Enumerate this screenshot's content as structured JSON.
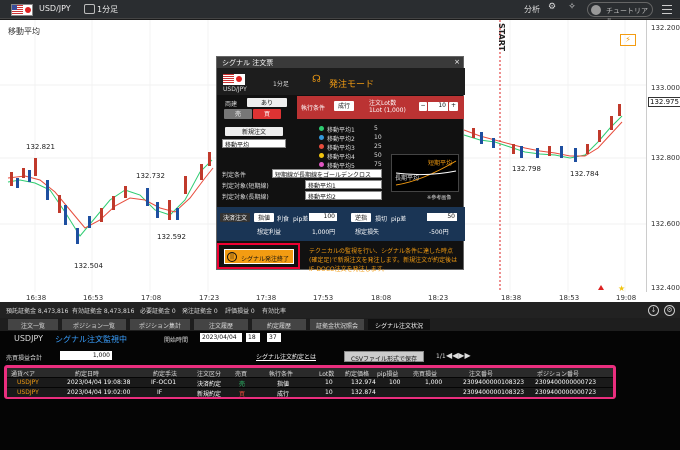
{
  "topbar": {
    "pair": "USD/JPY",
    "timeframe": "1分足",
    "analysis": "分析",
    "tutorial": "チュートリアル"
  },
  "chart": {
    "title": "移動平均",
    "start_label": "START",
    "yticks": [
      "132.200",
      "133.000",
      "132.975",
      "132.800",
      "132.600",
      "132.400"
    ],
    "xticks": [
      "16:38",
      "16:53",
      "17:08",
      "17:23",
      "17:38",
      "17:53",
      "18:08",
      "18:23",
      "18:38",
      "18:53",
      "19:08"
    ],
    "annotations": [
      "132.821",
      "132.732",
      "132.592",
      "132.504",
      "132.798",
      "132.784"
    ]
  },
  "modal": {
    "title": "シグナル 注文票",
    "pair": "USD/JPY",
    "tf": "1分足",
    "mode": "発注モード",
    "open_label": "両建",
    "open_value": "あり",
    "sell": "売",
    "buy": "買",
    "order_cond": "執行条件",
    "exec": "成行",
    "lot_label": "注文Lot数",
    "lot_sub": "1Lot (1,000)",
    "lot_value": "10",
    "new_order": "新規注文",
    "indicator": "移動平均",
    "ma": [
      {
        "n": "移動平均1",
        "v": "5",
        "c": "#2ecc71"
      },
      {
        "n": "移動平均2",
        "v": "10",
        "c": "#3498db"
      },
      {
        "n": "移動平均3",
        "v": "25",
        "c": "#e74c3c"
      },
      {
        "n": "移動平均4",
        "v": "50",
        "c": "#f1c40f"
      },
      {
        "n": "移動平均5",
        "v": "75",
        "c": "#e056c1"
      }
    ],
    "judge_cond": "判定条件",
    "judge_cond_v": "短期線が長期線をゴールデンクロス",
    "judge_short": "判定対象(短期線)",
    "judge_short_v": "移動平均1",
    "judge_long": "判定対象(長期線)",
    "judge_long_v": "移動平均2",
    "illu_short": "短期平均",
    "illu_long": "長期平均",
    "ref": "※参考画像",
    "settle": "決済注文",
    "limit": "指値",
    "stop": "逆指",
    "profit": "利食",
    "loss": "損切",
    "pips": "pip差",
    "limit_v": "100",
    "stop_v": "50",
    "profit_v": "想定利益",
    "profit_amt": "1,000円",
    "loss_v": "想定損失",
    "loss_amt": "-500円",
    "end_btn": "シグナル発注終了",
    "note": "テクニカルの監視を行い、シグナル条件に達した時点(確定足)で新規注文を発注します。新規注文が約定後はIF-DOCO注文を発注します。"
  },
  "strip": {
    "items": [
      "預託証拠金 8,473,816",
      "有効証拠金 8,473,816",
      "必要証拠金 0",
      "発注証拠金 0",
      "評価損益 0",
      "有効比率"
    ]
  },
  "tabs": [
    "注文一覧",
    "ポジション一覧",
    "ポジション集計",
    "注文履歴",
    "約定履歴",
    "証拠金状況照会",
    "シグナル注文状況"
  ],
  "panel": {
    "pair": "USDJPY",
    "monitor": "シグナル注文監視中",
    "start_label": "開始時間",
    "date": "2023/04/04",
    "hh": "18",
    "mm": "37",
    "pl_label": "売買損益合計",
    "pl_value": "1,000",
    "link": "シグナル注文約定とは",
    "csv": "CSVファイル形式で保存",
    "page": "1/1",
    "headers": [
      "通貨ペア",
      "約定日時",
      "約定手法",
      "注文区分",
      "売買",
      "執行条件",
      "Lot数",
      "約定価格",
      "pip損益",
      "売買損益",
      "注文番号",
      "ポジション番号"
    ],
    "rows": [
      [
        "USDJPY",
        "2023/04/04 19:08:38",
        "IF-OCO1",
        "決済約定",
        "売",
        "指値",
        "10",
        "132.974",
        "100",
        "1,000",
        "2309400000108323",
        "2309400000000723"
      ],
      [
        "USDJPY",
        "2023/04/04 19:02:00",
        "IF",
        "新規約定",
        "買",
        "成行",
        "10",
        "132.874",
        "",
        "",
        "2309400000108323",
        "2309400000000723"
      ]
    ]
  }
}
